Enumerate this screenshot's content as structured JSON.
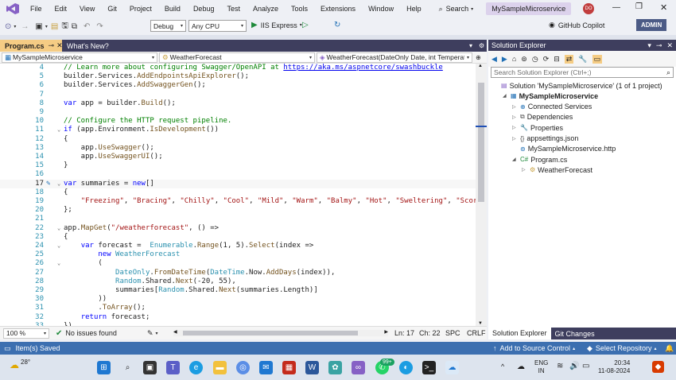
{
  "titlebar": {
    "menu": [
      "File",
      "Edit",
      "View",
      "Git",
      "Project",
      "Build",
      "Debug",
      "Test",
      "Analyze",
      "Tools",
      "Extensions",
      "Window",
      "Help"
    ],
    "search_label": "Search",
    "solution_name": "MySampleMicroservice",
    "avatar_initials": "DO"
  },
  "toolbar": {
    "config": "Debug",
    "platform": "Any CPU",
    "run_target": "IIS Express",
    "copilot_label": "GitHub Copilot",
    "admin_label": "ADMIN"
  },
  "tabs": [
    {
      "label": "Program.cs",
      "active": true
    },
    {
      "label": "What's New?",
      "active": false
    }
  ],
  "navbar": {
    "project": "MySampleMicroservice",
    "type": "WeatherForecast",
    "member": "WeatherForecast(DateOnly Date, int TemperatureC"
  },
  "code_lines": [
    {
      "n": "4",
      "tokens": [
        [
          "cm",
          "// Learn more about configuring Swagger/OpenAPI at "
        ],
        [
          "lk",
          "https://aka.ms/aspnetcore/swashbuckle"
        ]
      ]
    },
    {
      "n": "5",
      "tokens": [
        [
          "",
          "builder."
        ],
        [
          "",
          "Services"
        ],
        [
          "",
          "."
        ],
        [
          "mt",
          "AddEndpointsApiExplorer"
        ],
        [
          "",
          "();"
        ]
      ]
    },
    {
      "n": "6",
      "tokens": [
        [
          "",
          "builder."
        ],
        [
          "",
          "Services"
        ],
        [
          "",
          "."
        ],
        [
          "mt",
          "AddSwaggerGen"
        ],
        [
          "",
          "();"
        ]
      ]
    },
    {
      "n": "7",
      "tokens": []
    },
    {
      "n": "8",
      "tokens": [
        [
          "kw",
          "var"
        ],
        [
          "",
          " app = builder."
        ],
        [
          "mt",
          "Build"
        ],
        [
          "",
          "();"
        ]
      ]
    },
    {
      "n": "9",
      "tokens": []
    },
    {
      "n": "10",
      "tokens": [
        [
          "cm",
          "// Configure the HTTP request pipeline."
        ]
      ]
    },
    {
      "n": "11",
      "tokens": [
        [
          "kw",
          "if"
        ],
        [
          "",
          " (app.Environment."
        ],
        [
          "mt",
          "IsDevelopment"
        ],
        [
          "",
          "())"
        ]
      ]
    },
    {
      "n": "12",
      "tokens": [
        [
          "",
          "{"
        ]
      ]
    },
    {
      "n": "13",
      "tokens": [
        [
          "",
          "    app."
        ],
        [
          "mt",
          "UseSwagger"
        ],
        [
          "",
          "();"
        ]
      ]
    },
    {
      "n": "14",
      "tokens": [
        [
          "",
          "    app."
        ],
        [
          "mt",
          "UseSwaggerUI"
        ],
        [
          "",
          "();"
        ]
      ]
    },
    {
      "n": "15",
      "tokens": [
        [
          "",
          "}"
        ]
      ]
    },
    {
      "n": "16",
      "tokens": []
    },
    {
      "n": "17",
      "tokens": [
        [
          "kw",
          "var"
        ],
        [
          "",
          " summaries = "
        ],
        [
          "kw",
          "new"
        ],
        [
          "",
          "[]"
        ]
      ]
    },
    {
      "n": "18",
      "tokens": [
        [
          "",
          "{"
        ]
      ]
    },
    {
      "n": "19",
      "tokens": [
        [
          "",
          "    "
        ],
        [
          "st",
          "\"Freezing\""
        ],
        [
          "",
          ", "
        ],
        [
          "st",
          "\"Bracing\""
        ],
        [
          "",
          ", "
        ],
        [
          "st",
          "\"Chilly\""
        ],
        [
          "",
          ", "
        ],
        [
          "st",
          "\"Cool\""
        ],
        [
          "",
          ", "
        ],
        [
          "st",
          "\"Mild\""
        ],
        [
          "",
          ", "
        ],
        [
          "st",
          "\"Warm\""
        ],
        [
          "",
          ", "
        ],
        [
          "st",
          "\"Balmy\""
        ],
        [
          "",
          ", "
        ],
        [
          "st",
          "\"Hot\""
        ],
        [
          "",
          ", "
        ],
        [
          "st",
          "\"Sweltering\""
        ],
        [
          "",
          ", "
        ],
        [
          "st",
          "\"Scorching\""
        ]
      ]
    },
    {
      "n": "20",
      "tokens": [
        [
          "",
          "};"
        ]
      ]
    },
    {
      "n": "21",
      "tokens": []
    },
    {
      "n": "22",
      "tokens": [
        [
          "",
          "app."
        ],
        [
          "mt",
          "MapGet"
        ],
        [
          "",
          "("
        ],
        [
          "st",
          "\"/weatherforecast\""
        ],
        [
          "",
          ", () =>"
        ]
      ]
    },
    {
      "n": "23",
      "tokens": [
        [
          "",
          "{"
        ]
      ]
    },
    {
      "n": "24",
      "tokens": [
        [
          "",
          "    "
        ],
        [
          "kw",
          "var"
        ],
        [
          "",
          " forecast =  "
        ],
        [
          "ty",
          "Enumerable"
        ],
        [
          "",
          "."
        ],
        [
          "mt",
          "Range"
        ],
        [
          "",
          "(1, 5)."
        ],
        [
          "mt",
          "Select"
        ],
        [
          "",
          "(index =>"
        ]
      ]
    },
    {
      "n": "25",
      "tokens": [
        [
          "",
          "        "
        ],
        [
          "kw",
          "new"
        ],
        [
          "",
          " "
        ],
        [
          "ty",
          "WeatherForecast"
        ]
      ]
    },
    {
      "n": "26",
      "tokens": [
        [
          "",
          "        ("
        ]
      ]
    },
    {
      "n": "27",
      "tokens": [
        [
          "",
          "            "
        ],
        [
          "ty",
          "DateOnly"
        ],
        [
          "",
          "."
        ],
        [
          "mt",
          "FromDateTime"
        ],
        [
          "",
          "("
        ],
        [
          "ty",
          "DateTime"
        ],
        [
          "",
          ".Now."
        ],
        [
          "mt",
          "AddDays"
        ],
        [
          "",
          "(index)),"
        ]
      ]
    },
    {
      "n": "28",
      "tokens": [
        [
          "",
          "            "
        ],
        [
          "ty",
          "Random"
        ],
        [
          "",
          ".Shared."
        ],
        [
          "mt",
          "Next"
        ],
        [
          "",
          "(-20, 55),"
        ]
      ]
    },
    {
      "n": "29",
      "tokens": [
        [
          "",
          "            summaries["
        ],
        [
          "ty",
          "Random"
        ],
        [
          "",
          ".Shared."
        ],
        [
          "mt",
          "Next"
        ],
        [
          "",
          "(summaries.Length)]"
        ]
      ]
    },
    {
      "n": "30",
      "tokens": [
        [
          "",
          "        ))"
        ]
      ]
    },
    {
      "n": "31",
      "tokens": [
        [
          "",
          "        ."
        ],
        [
          "mt",
          "ToArray"
        ],
        [
          "",
          "();"
        ]
      ]
    },
    {
      "n": "32",
      "tokens": [
        [
          "",
          "    "
        ],
        [
          "kw",
          "return"
        ],
        [
          "",
          " forecast;"
        ]
      ]
    },
    {
      "n": "33",
      "tokens": [
        [
          "",
          "})"
        ]
      ]
    }
  ],
  "editor_status": {
    "zoom": "100 %",
    "issues": "No issues found",
    "line": "Ln: 17",
    "col": "Ch: 22",
    "spc": "SPC",
    "crlf": "CRLF"
  },
  "solution_explorer": {
    "title": "Solution Explorer",
    "search_placeholder": "Search Solution Explorer (Ctrl+;)",
    "solution": "Solution 'MySampleMicroservice' (1 of 1 project)",
    "project": "MySampleMicroservice",
    "items": [
      {
        "label": "Connected Services",
        "icon": "connected-services-icon",
        "indent": 2
      },
      {
        "label": "Dependencies",
        "icon": "dependencies-icon",
        "indent": 2
      },
      {
        "label": "Properties",
        "icon": "properties-icon",
        "indent": 2
      },
      {
        "label": "appsettings.json",
        "icon": "json-file-icon",
        "indent": 2
      },
      {
        "label": "MySampleMicroservice.http",
        "icon": "http-file-icon",
        "indent": 2
      },
      {
        "label": "Program.cs",
        "icon": "csharp-file-icon",
        "indent": 2
      },
      {
        "label": "WeatherForecast",
        "icon": "class-icon",
        "indent": 3
      }
    ],
    "bottom_tabs": [
      "Solution Explorer",
      "Git Changes"
    ]
  },
  "statusbar": {
    "left": "Item(s) Saved",
    "source_control": "Add to Source Control",
    "repository": "Select Repository"
  },
  "taskbar": {
    "temperature": "28°",
    "lang": "ENG",
    "region": "IN",
    "time": "20:34",
    "date": "11-08-2024",
    "badge": "99+"
  },
  "colors": {
    "accent": "#68217a",
    "statusbar": "#3c6fb0",
    "tab_strip": "#3e3e5e",
    "active_tab": "#f5cc84"
  }
}
